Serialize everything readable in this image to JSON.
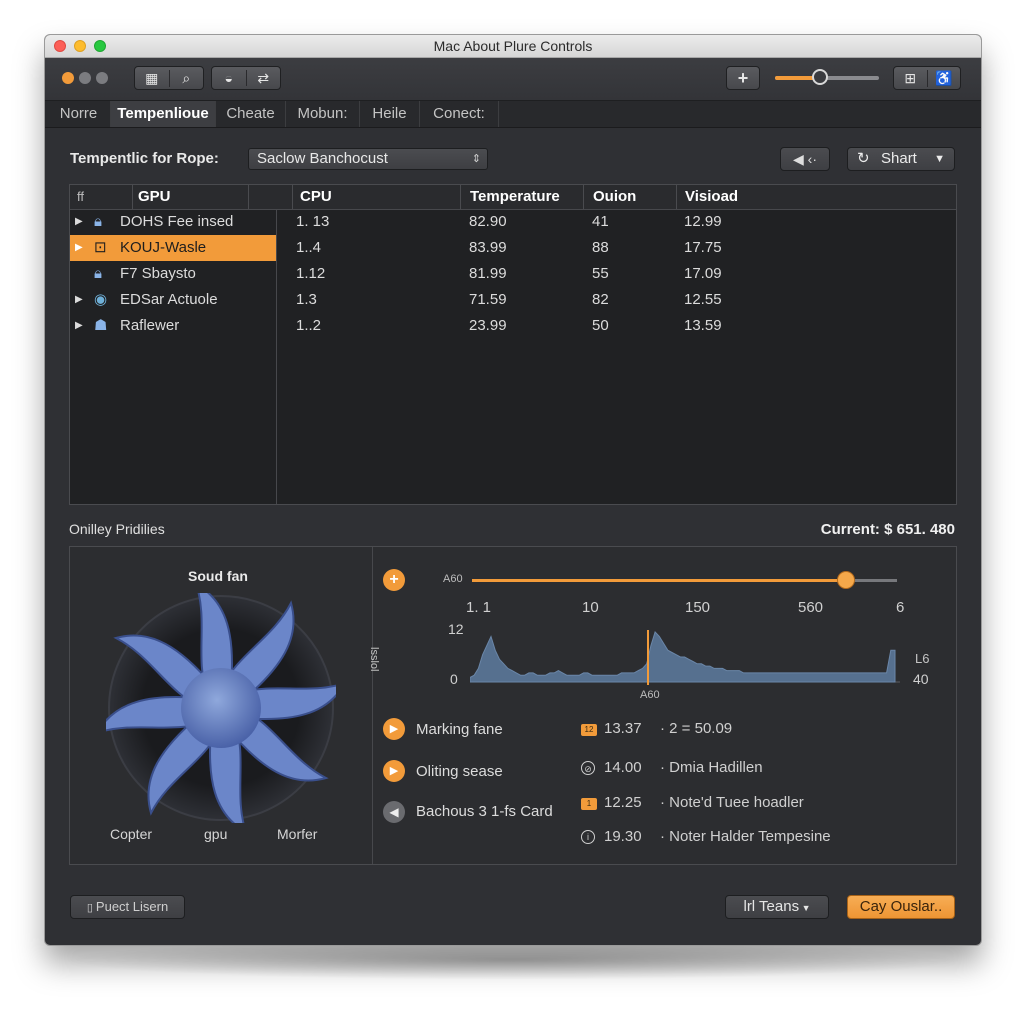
{
  "window": {
    "title": "Mac About Plure Controls"
  },
  "toolbar": {
    "grid_icon": "▦",
    "search_icon": "⌕",
    "user_icon": "◒",
    "sync_icon": "⇄",
    "add_icon": "+",
    "slider_value": 0.43,
    "export_icon": "⊞",
    "accessibility_icon": "♿"
  },
  "tabs": [
    {
      "label": "Norre",
      "active": false
    },
    {
      "label": "Tempenlioue",
      "active": true
    },
    {
      "label": "Cheate",
      "active": false
    },
    {
      "label": "Mobun:",
      "active": false
    },
    {
      "label": "Heile",
      "active": false
    },
    {
      "label": "Conect:",
      "active": false
    }
  ],
  "filter": {
    "label": "Tempentlic for Rope:",
    "select_value": "Saclow Banchocust",
    "back_label": "◀ ‹·",
    "share_label": "Shart"
  },
  "table": {
    "tree_header": "GPU",
    "tree_hash": "ff",
    "columns": [
      "CPU",
      "Temperature",
      "Ouion",
      "Visioad"
    ],
    "rows": [
      {
        "name": "DOHS Fee insed",
        "cpu": "1. 13",
        "temperature": "82.90",
        "ouion": "41",
        "visioad": "12.99",
        "selected": false,
        "expandable": true
      },
      {
        "name": "KOUJ-Wasle",
        "cpu": "1..4",
        "temperature": "83.99",
        "ouion": "88",
        "visioad": "17.75",
        "selected": true,
        "expandable": true
      },
      {
        "name": "F7 Sbaysto",
        "cpu": "1.12",
        "temperature": "81.99",
        "ouion": "55",
        "visioad": "17.09",
        "selected": false,
        "expandable": false
      },
      {
        "name": "EDSar Actuole",
        "cpu": "1.3",
        "temperature": "71.59",
        "ouion": "82",
        "visioad": "12.55",
        "selected": false,
        "expandable": true
      },
      {
        "name": "Raflewer",
        "cpu": "1..2",
        "temperature": "23.99",
        "ouion": "50",
        "visioad": "13.59",
        "selected": false,
        "expandable": true
      }
    ]
  },
  "profiles": {
    "label": "Onilley Pridilies",
    "current_label": "Current: $ 651. 480"
  },
  "fan": {
    "title": "Soud fan",
    "labels": [
      "Copter",
      "gpu",
      "Morfer"
    ]
  },
  "graph": {
    "slider_left_label": "A60",
    "slider_value": 0.88,
    "scale_labels": [
      "1. 1",
      "10",
      "150",
      "560",
      "6"
    ],
    "y_axis_label": "lsslol",
    "y_top": "12",
    "y_bottom": "0",
    "right_top": "L6",
    "right_bottom": "40",
    "marker_label": "A60",
    "histogram": [
      2,
      3,
      6,
      12,
      16,
      20,
      14,
      10,
      8,
      6,
      5,
      4,
      3,
      3,
      4,
      4,
      3,
      3,
      3,
      4,
      4,
      5,
      4,
      3,
      3,
      3,
      3,
      4,
      4,
      3,
      3,
      3,
      3,
      3,
      3,
      3,
      4,
      4,
      4,
      4,
      5,
      6,
      8,
      16,
      22,
      20,
      17,
      14,
      13,
      12,
      11,
      11,
      10,
      9,
      8,
      8,
      7,
      7,
      6,
      6,
      6,
      5,
      5,
      5,
      5,
      4,
      4,
      4,
      4,
      4,
      4,
      4,
      4,
      4,
      4,
      4,
      4,
      4,
      4,
      4,
      4,
      4,
      4,
      4,
      4,
      4,
      4,
      4,
      4,
      4,
      4,
      4,
      4,
      4,
      4,
      4,
      4,
      4,
      4,
      4,
      14,
      14
    ]
  },
  "actions": [
    {
      "label": "Marking fane",
      "icon": "play-icon"
    },
    {
      "label": "Oliting sease",
      "icon": "play-icon"
    },
    {
      "label": "Bachous 3 1-fs Card",
      "icon": "back-icon"
    }
  ],
  "readouts": [
    {
      "badge": "12",
      "value": "13.37",
      "desc": "· 2 = 50.09",
      "style": "orange-square"
    },
    {
      "badge": "⊘",
      "value": "14.00",
      "desc": "· Dmia Hadillen",
      "style": "circle"
    },
    {
      "badge": "1",
      "value": "12.25",
      "desc": "· Note'd Tuee hoadler",
      "style": "orange-square"
    },
    {
      "badge": "i",
      "value": "19.30",
      "desc": "· Noter Halder Tempesine",
      "style": "circle"
    }
  ],
  "footer": {
    "left_button": "Puect Lisern",
    "middle_button": "lrl Teans",
    "right_button": "Cay Ouslar.."
  }
}
